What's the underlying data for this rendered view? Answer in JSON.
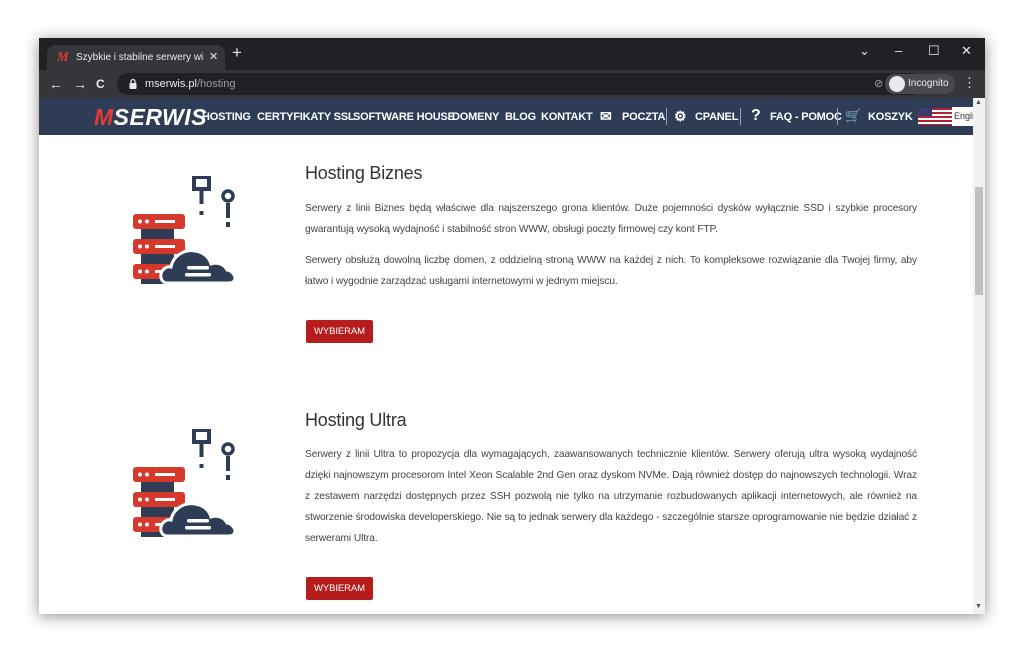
{
  "browser": {
    "tab_title": "Szybkie i stabilne serwery wirtualne",
    "tab_close": "✕",
    "new_tab": "+",
    "win_chevron": "⌄",
    "win_min": "–",
    "win_max": "☐",
    "win_close": "✕",
    "url_host": "mserwis.pl",
    "url_path": "/hosting",
    "incognito_label": "Incognito",
    "back": "←",
    "forward": "→",
    "reload": "C",
    "star": "☆",
    "eye": "⊘",
    "menu": "⋮"
  },
  "site": {
    "logo_m": "M",
    "logo_rest": "SERWIS",
    "nav": {
      "hosting": "HOSTING",
      "ssl": "CERTYFIKATY SSL",
      "software": "SOFTWARE HOUSE",
      "domeny": "DOMENY",
      "blog": "BLOG",
      "kontakt": "KONTAKT",
      "poczta": "POCZTA",
      "cpanel": "CPANEL",
      "faq": "FAQ - POMOC",
      "koszyk": "KOSZYK",
      "lang": "English",
      "faq_icon": "?",
      "gear_icon": "⚙",
      "cart_icon": "🛒",
      "mail_icon": "✉"
    }
  },
  "plans": [
    {
      "title": "Hosting Biznes",
      "p1": "Serwery z linii Biznes będą właściwe dla najszerszego grona klientów. Duże pojemności dysków wyłącznie SSD i szybkie procesory gwarantują wysoką wydajność i stabilność stron WWW, obsługi poczty firmowej czy kont FTP.",
      "p2": "Serwery obsłużą dowolną liczbę domen, z oddzielną stroną WWW na każdej z nich. To kompleksowe rozwiązanie dla Twojej firmy, aby łatwo i wygodnie zarządzać usługami internetowymi w jednym miejscu.",
      "button": "WYBIERAM"
    },
    {
      "title": "Hosting Ultra",
      "p1": "Serwery z linii Ultra to propozycja dla wymagających, zaawansowanych technicznie klientów. Serwery oferują ultra wysoką wydajność dzięki najnowszym procesorom Intel Xeon Scalable 2nd Gen oraz dyskom NVMe. Dają również dostęp do najnowszych technologii. Wraz z zestawem narzędzi dostępnych przez SSH pozwolą nie tylko na utrzymanie rozbudowanych aplikacji internetowych, ale również na stworzenie środowiska developerskiego. Nie są to jednak serwery dla każdego - szczególnie starsze oprogramowanie nie będzie działać z serwerami Ultra.",
      "button": "WYBIERAM"
    }
  ],
  "colors": {
    "nav_bg": "#2e3d55",
    "brand_red": "#e53935",
    "button_red": "#b71c1c",
    "icon_navy": "#2e3d55",
    "icon_red": "#d6392b"
  }
}
